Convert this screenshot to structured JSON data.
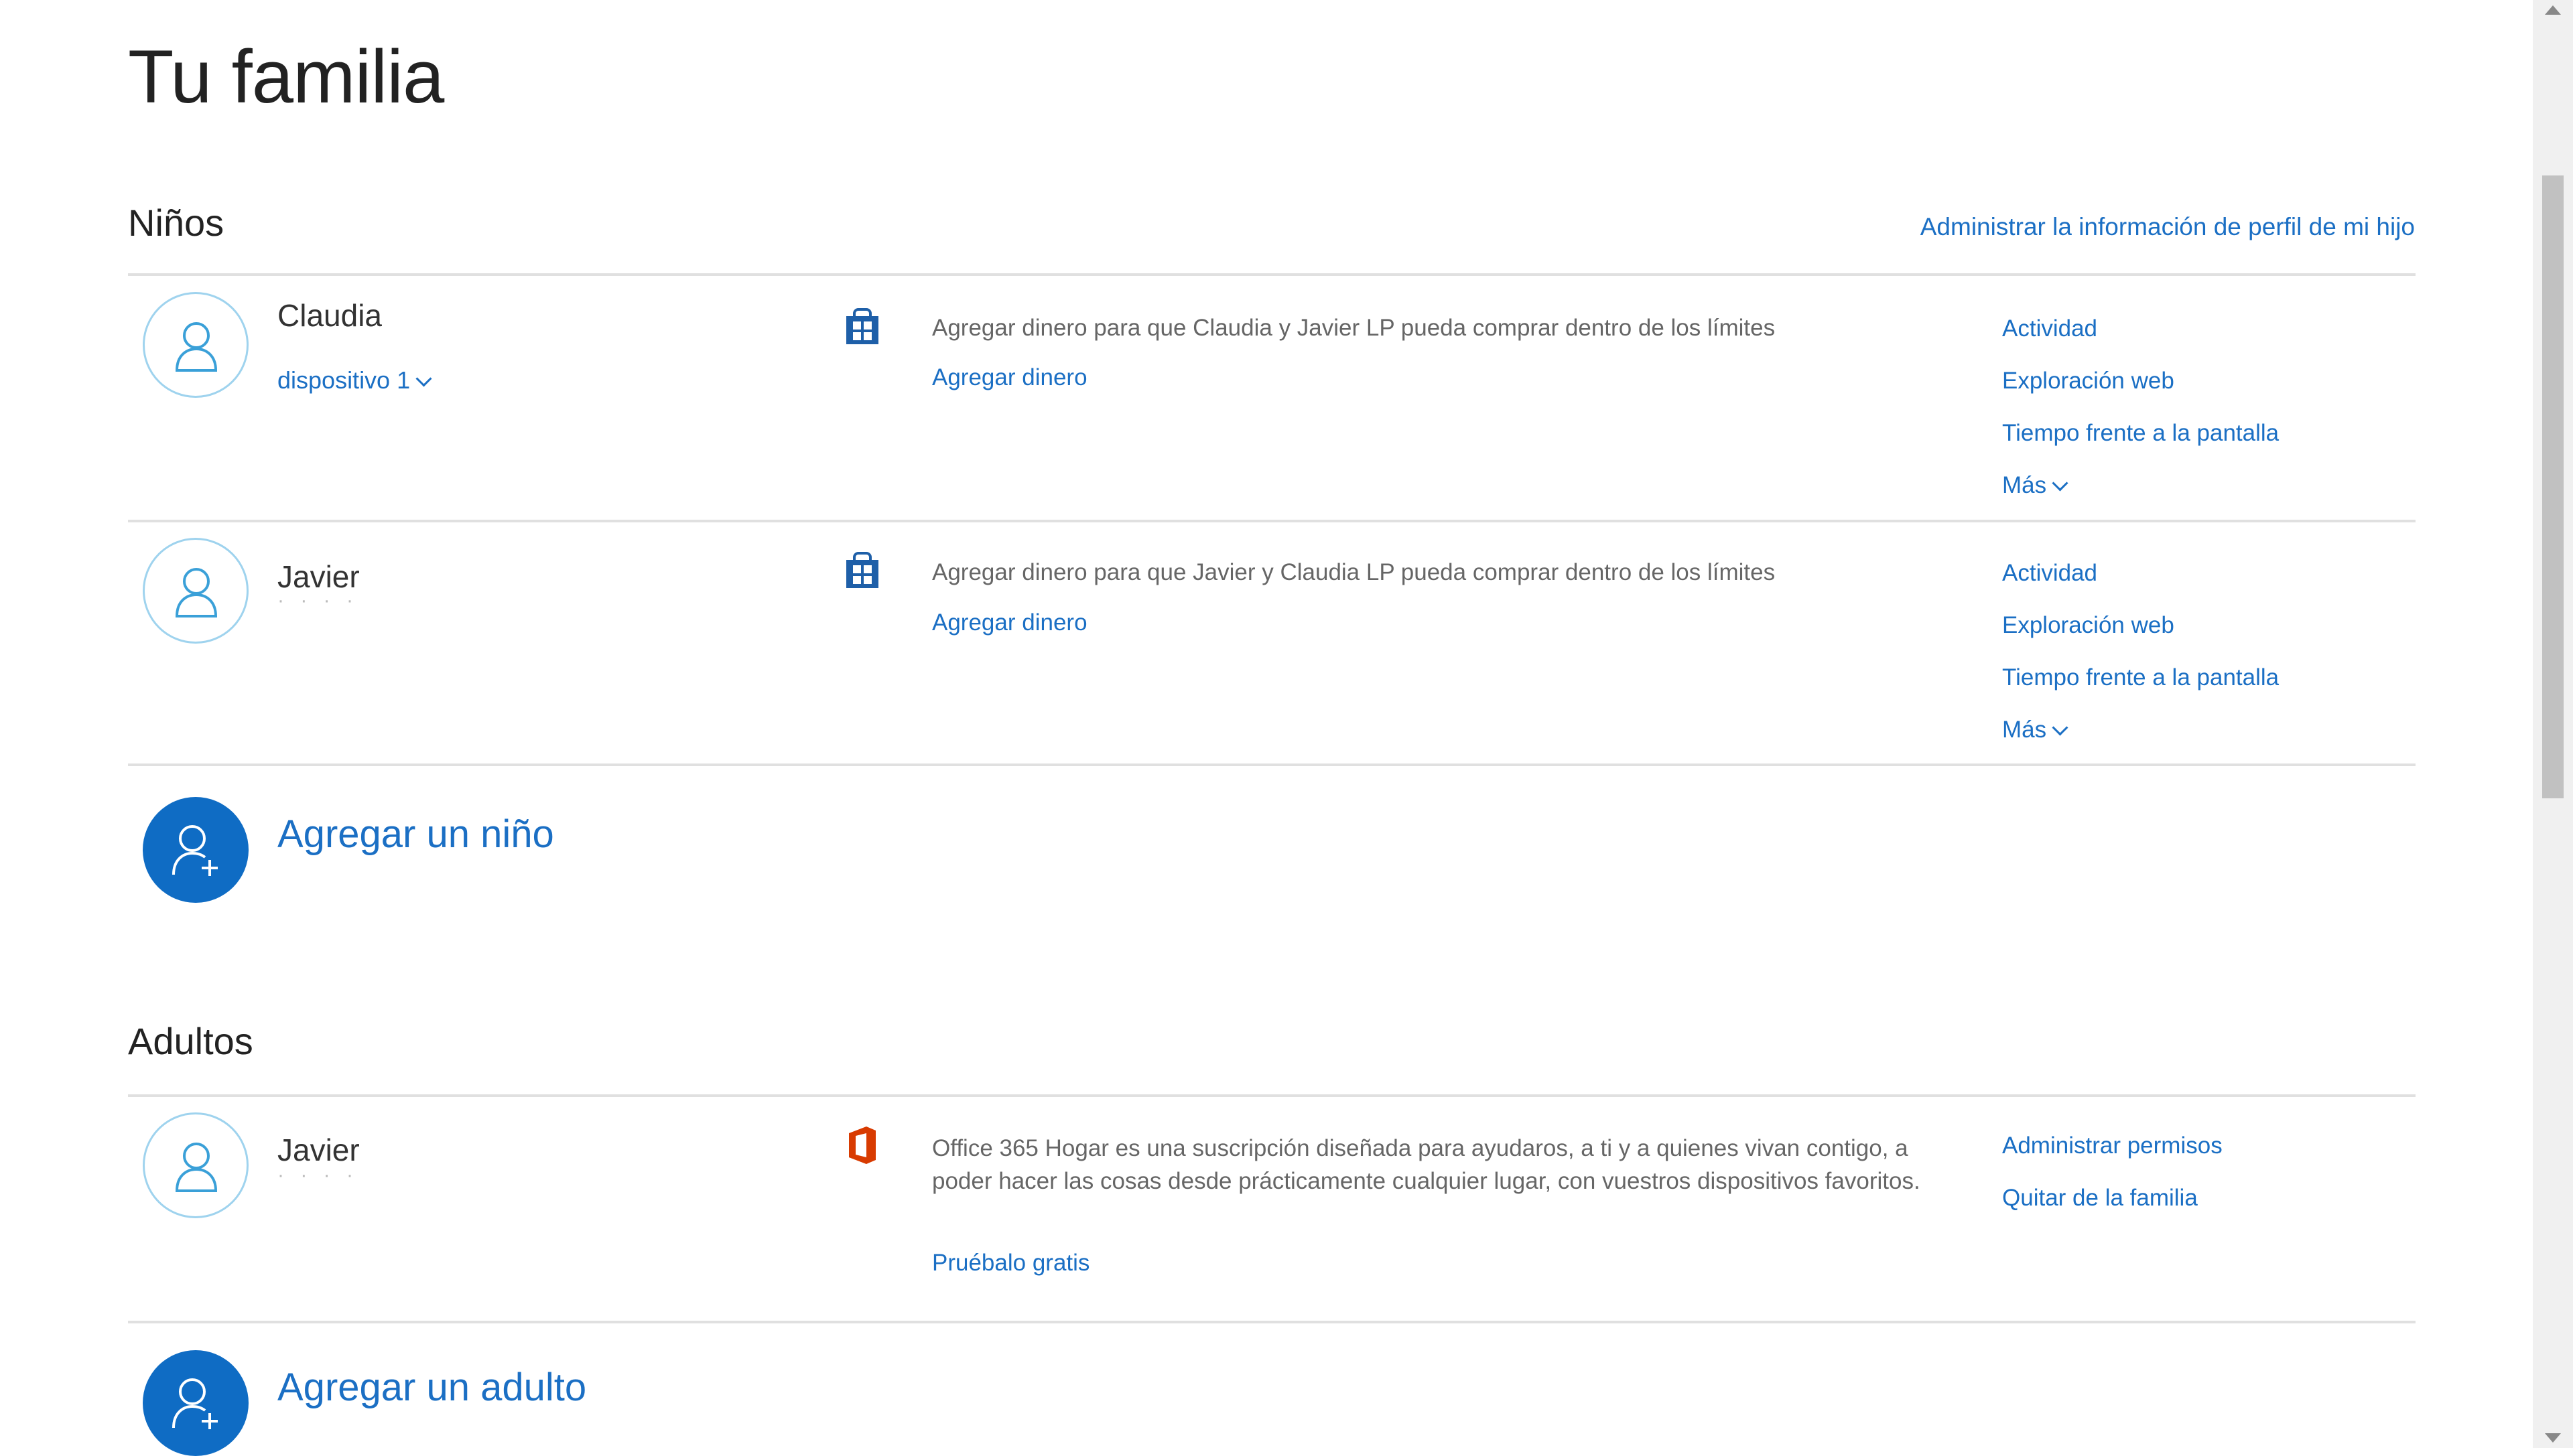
{
  "page": {
    "title": "Tu familia"
  },
  "children_section": {
    "title": "Niños",
    "manage_link": "Administrar la información de perfil de mi hijo",
    "members": [
      {
        "name": "Claudia",
        "device_label": "dispositivo 1",
        "description": "Agregar dinero para que Claudia y Javier LP pueda comprar dentro de los límites",
        "link": "Agregar dinero",
        "actions": [
          "Actividad",
          "Exploración web",
          "Tiempo frente a la pantalla",
          "Más"
        ]
      },
      {
        "name": "Javier",
        "description": "Agregar dinero para que Javier y Claudia LP pueda comprar dentro de los límites",
        "link": "Agregar dinero",
        "actions": [
          "Actividad",
          "Exploración web",
          "Tiempo frente a la pantalla",
          "Más"
        ]
      }
    ],
    "add_label": "Agregar un niño"
  },
  "adults_section": {
    "title": "Adultos",
    "members": [
      {
        "name": "Javier",
        "description": "Office 365 Hogar es una suscripción diseñada para ayudaros, a ti y a quienes vivan contigo, a poder hacer las cosas desde prácticamente cualquier lugar, con vuestros dispositivos favoritos.",
        "link": "Pruébalo gratis",
        "actions": [
          "Administrar permisos",
          "Quitar de la familia"
        ]
      }
    ],
    "add_label": "Agregar un adulto"
  },
  "colors": {
    "accent": "#0f6cc4",
    "link": "#1b6fc4",
    "office": "#d83b01"
  }
}
